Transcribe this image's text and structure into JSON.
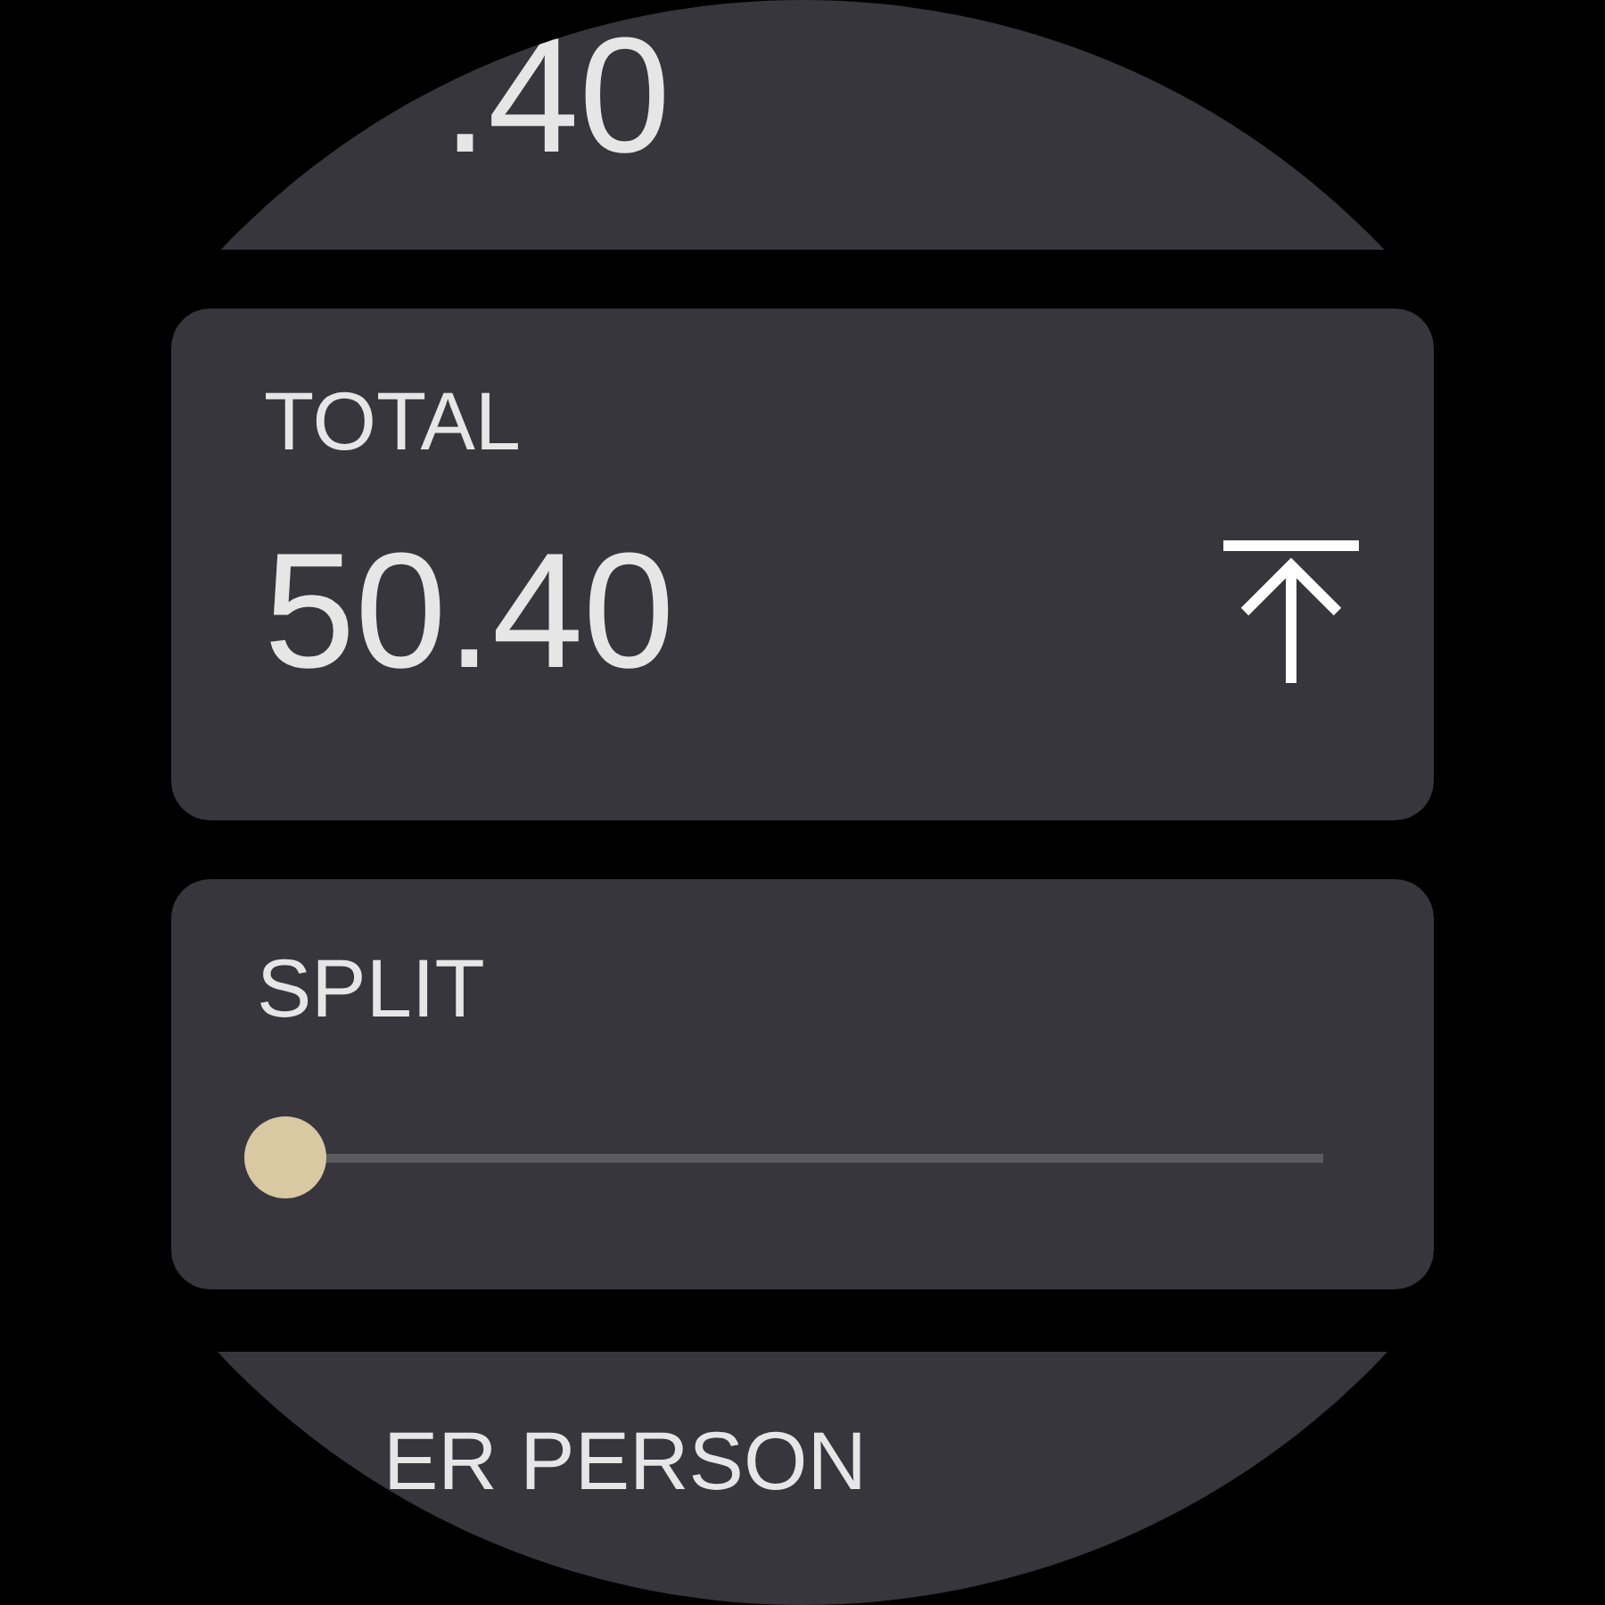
{
  "previous_card": {
    "value": ".40"
  },
  "total": {
    "label": "TOTAL",
    "value": "50.40"
  },
  "split": {
    "label": "SPLIT",
    "level": 0
  },
  "next_card": {
    "label": "ER PERSON"
  }
}
